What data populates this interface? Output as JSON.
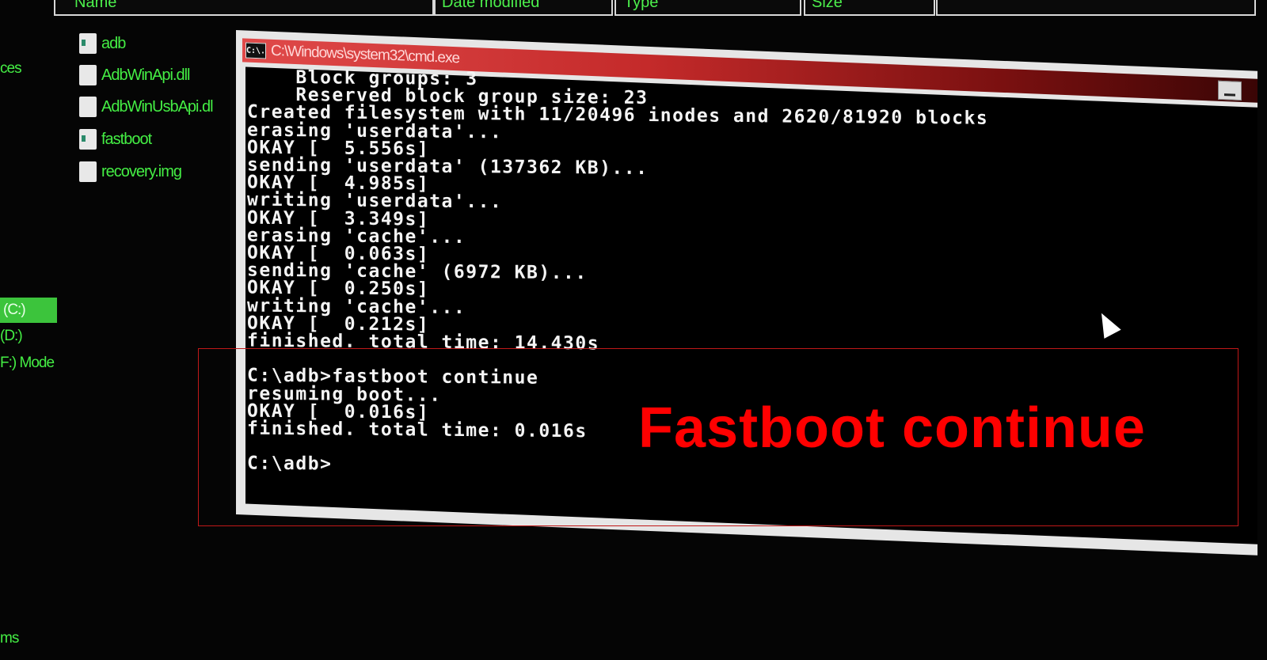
{
  "explorer": {
    "columns": [
      "Name",
      "Date modified",
      "Type",
      "Size"
    ],
    "files": [
      {
        "name": "adb",
        "icon": "exe-file-icon"
      },
      {
        "name": "AdbWinApi.dll",
        "icon": "dll-file-icon"
      },
      {
        "name": "AdbWinUsbApi.dl",
        "icon": "dll-file-icon"
      },
      {
        "name": "fastboot",
        "icon": "exe-file-icon"
      },
      {
        "name": "recovery.img",
        "icon": "file-icon"
      }
    ],
    "sidebar": [
      "ces",
      "(C:)",
      "(D:)",
      "F:) Mode",
      "ms"
    ]
  },
  "cmd": {
    "title": "C:\\Windows\\system32\\cmd.exe",
    "icon_text": "C:\\.",
    "lines": [
      "    Block groups: 3",
      "    Reserved block group size: 23",
      "Created filesystem with 11/20496 inodes and 2620/81920 blocks",
      "erasing 'userdata'...",
      "OKAY [  5.556s]",
      "sending 'userdata' (137362 KB)...",
      "OKAY [  4.985s]",
      "writing 'userdata'...",
      "OKAY [  3.349s]",
      "erasing 'cache'...",
      "OKAY [  0.063s]",
      "sending 'cache' (6972 KB)...",
      "OKAY [  0.250s]",
      "writing 'cache'...",
      "OKAY [  0.212s]",
      "finished. total time: 14.430s",
      "",
      "C:\\adb>fastboot continue",
      "resuming boot...",
      "OKAY [  0.016s]",
      "finished. total time: 0.016s",
      "",
      "C:\\adb>"
    ]
  },
  "caption": "Fastboot continue",
  "colors": {
    "caption": "#ff0000",
    "explorer_text": "#44ee44",
    "titlebar": "#e04a4a"
  }
}
